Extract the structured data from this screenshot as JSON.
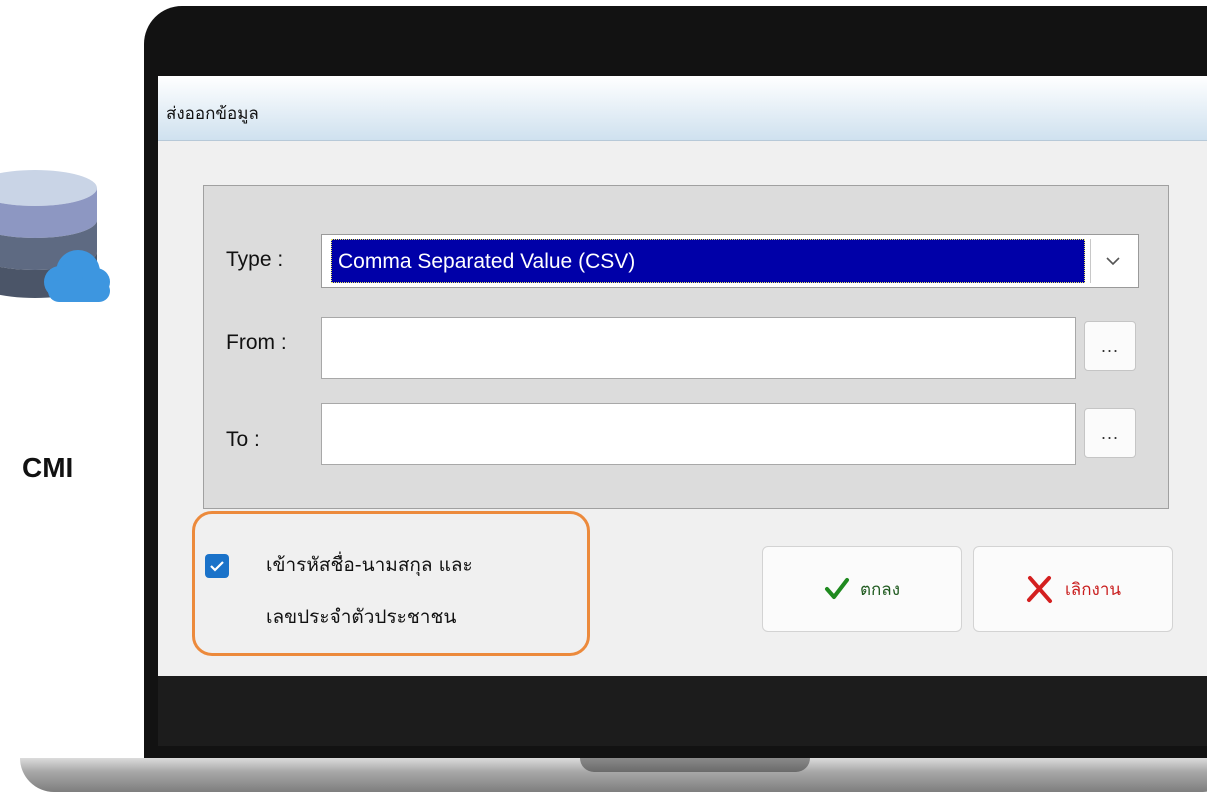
{
  "logo": {
    "text": "CMI"
  },
  "dialog": {
    "title": "ส่งออกข้อมูล",
    "type_label": "Type :",
    "type_value": "Comma Separated Value (CSV)",
    "from_label": "From :",
    "from_value": "",
    "to_label": "To :",
    "to_value": "",
    "browse_label": "...",
    "checkbox": {
      "checked": true,
      "line1": "เข้ารหัสชื่อ-นามสกุล และ",
      "line2": "เลขประจำตัวประชาชน"
    },
    "ok_label": "ตกลง",
    "cancel_label": "เลิกงาน"
  },
  "colors": {
    "selection": "#0000a8",
    "checkbox": "#1a72c9",
    "highlight": "#ec8a3c",
    "ok_icon": "#1f8a1f",
    "cancel_icon": "#d42020",
    "cancel_text": "#c91e1e"
  },
  "icons": {
    "logo": "database-cloud-icon",
    "checkbox": "check-icon",
    "ok": "checkmark-icon",
    "cancel": "x-mark-icon",
    "combo": "chevron-down-icon"
  }
}
